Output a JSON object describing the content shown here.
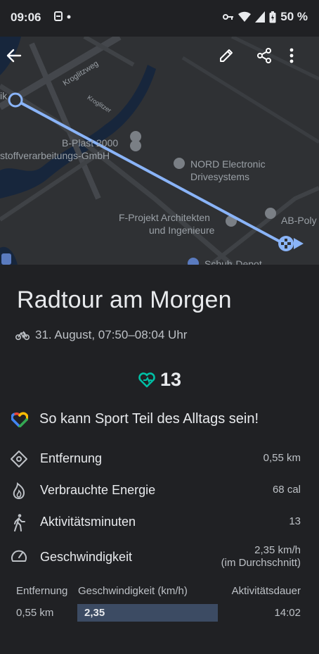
{
  "status": {
    "time": "09:06",
    "battery": "50 %"
  },
  "map": {
    "labels": {
      "street1": "Kroglitzweg",
      "street2": "Kroglitzer",
      "b_plast": "B-Plast 2000",
      "b_plast2": "stoffverarbeitungs-GmbH",
      "nord1": "NORD Electronic",
      "nord2": "Drivesystems",
      "fprojekt1": "F-Projekt Architekten",
      "fprojekt2": "und Ingenieure",
      "abpoly": "AB-Poly",
      "schuh": "Schuh-Depot",
      "ik": "ik"
    }
  },
  "activity": {
    "title": "Radtour am Morgen",
    "datetime": "31. August, 07:50–08:04 Uhr",
    "heart_points": "13",
    "tip": "So kann Sport Teil des Alltags sein!"
  },
  "metrics": [
    {
      "label": "Entfernung",
      "value": "0,55 km"
    },
    {
      "label": "Verbrauchte Energie",
      "value": "68 cal"
    },
    {
      "label": "Aktivitätsminuten",
      "value": "13"
    },
    {
      "label": "Geschwindigkeit",
      "value": "2,35 km/h",
      "sub": "(im Durchschnitt)"
    }
  ],
  "segments": {
    "headers": [
      "Entfernung",
      "Geschwindigkeit (km/h)",
      "Aktivitätsdauer"
    ],
    "rows": [
      {
        "distance": "0,55 km",
        "speed": "2,35",
        "duration": "14:02"
      }
    ]
  },
  "colors": {
    "accent": "#00bfa5",
    "route": "#8ab4f8",
    "bar": "#3c4b63"
  }
}
